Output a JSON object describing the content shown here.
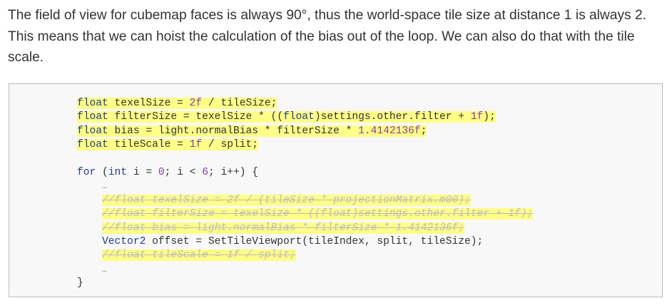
{
  "paragraph": "The field of view for cubemap faces is always 90°, thus the world-space tile size at distance 1 is always 2. This means that we can hoist the calculation of the bias out of the loop. We can also do that with the tile scale.",
  "code": {
    "l1": {
      "a": "float",
      "b": " texelSize = ",
      "c": "2f",
      "d": " / tileSize;"
    },
    "l2": {
      "a": "float",
      "b": " filterSize = texelSize * ((",
      "c": "float",
      "d": ")settings.other.filter + ",
      "e": "1f",
      "f": ");"
    },
    "l3": {
      "a": "float",
      "b": " bias = light.normalBias * filterSize * ",
      "c": "1.4142136f",
      "d": ";"
    },
    "l4": {
      "a": "float",
      "b": " tileScale = ",
      "c": "1f",
      "d": " / split;"
    },
    "l5": {
      "a": "for",
      "b": " (",
      "c": "int",
      "d": " i = ",
      "e": "0",
      "f": "; i < ",
      "g": "6",
      "h": "; i++) {"
    },
    "dots1": "…",
    "d1": "//float texelSize = 2f / (tileSize * projectionMatrix.m00);",
    "d2": "//float filterSize = texelSize * ((float)settings.other.filter + 1f);",
    "d3": "//float bias = light.normalBias * filterSize * 1.4142136f;",
    "v1": {
      "a": "Vector2",
      "b": " offset = SetTileViewport(tileIndex, split, tileSize);"
    },
    "d4": "//float tileScale = 1f / split;",
    "dots2": "…",
    "close": "}"
  }
}
